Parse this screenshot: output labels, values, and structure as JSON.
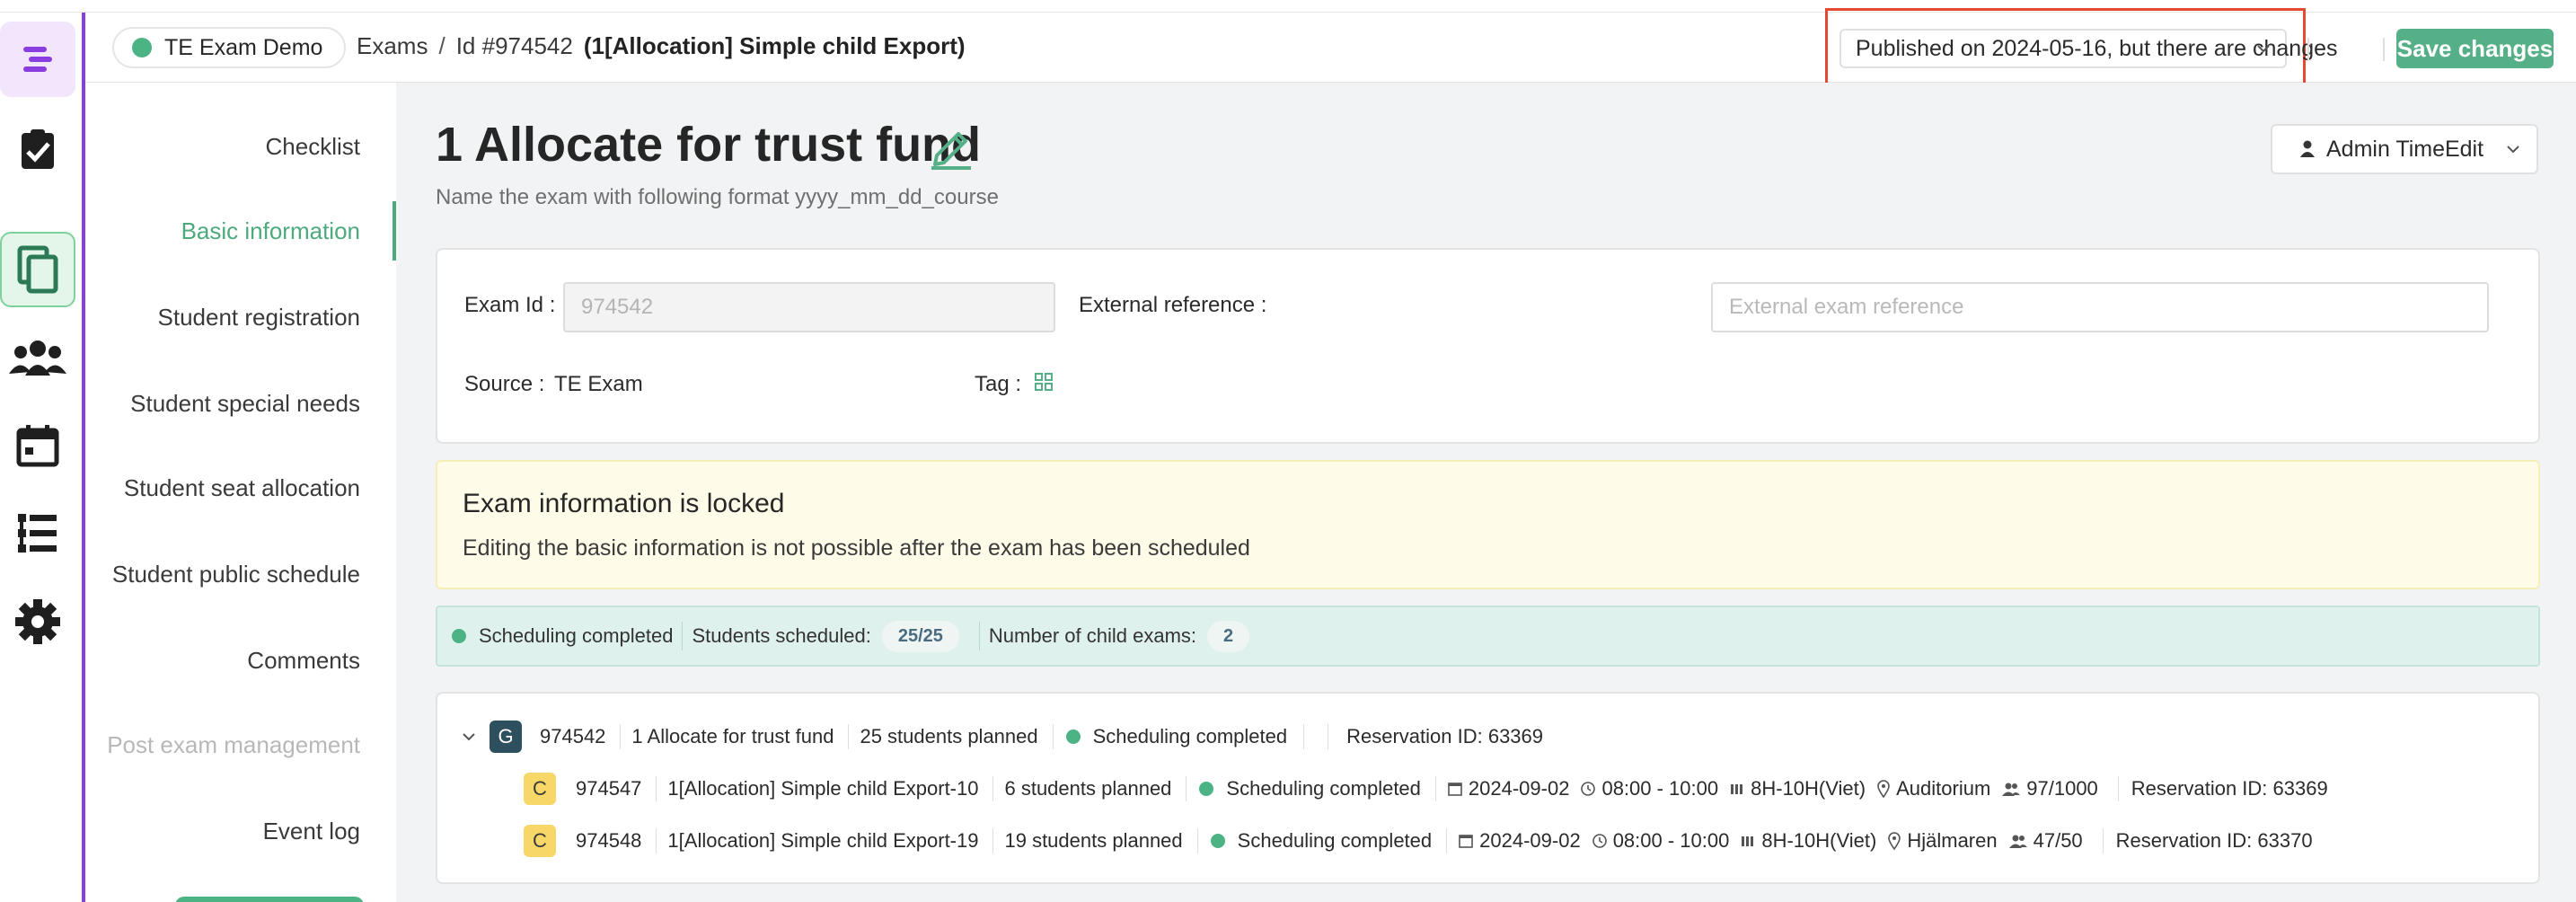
{
  "header": {
    "org_name": "TE Exam Demo",
    "breadcrumb_root": "Exams",
    "breadcrumb_sep": "/",
    "breadcrumb_id": "Id #974542",
    "breadcrumb_name": "(1[Allocation] Simple child Export)",
    "publish_status": "Published on 2024-05-16, but there are changes",
    "save_label": "Save changes",
    "colors": {
      "accent": "#55b087",
      "highlight": "#e44a33",
      "rail_line": "#8a3ee0"
    }
  },
  "rail": {
    "items": [
      {
        "name": "logo",
        "icon": "logo-icon"
      },
      {
        "name": "tasks",
        "icon": "clipboard-check-icon"
      },
      {
        "name": "exams",
        "icon": "copy-icon",
        "active": true
      },
      {
        "name": "users",
        "icon": "users-icon"
      },
      {
        "name": "calendar",
        "icon": "calendar-icon"
      },
      {
        "name": "list",
        "icon": "list-icon"
      },
      {
        "name": "settings",
        "icon": "gear-icon"
      }
    ]
  },
  "sections": {
    "items": [
      {
        "label": "Checklist"
      },
      {
        "label": "Basic information",
        "active": true
      },
      {
        "label": "Student registration"
      },
      {
        "label": "Student special needs"
      },
      {
        "label": "Student seat allocation"
      },
      {
        "label": "Student public schedule"
      },
      {
        "label": "Comments"
      },
      {
        "label": "Post exam management",
        "disabled": true
      },
      {
        "label": "Event log"
      }
    ]
  },
  "main": {
    "title": "1 Allocate for trust fund",
    "subtitle": "Name the exam with following format yyyy_mm_dd_course",
    "user_menu": "Admin TimeEdit"
  },
  "basic_info": {
    "exam_id_label": "Exam Id :",
    "exam_id_value": "974542",
    "external_ref_label": "External reference :",
    "external_ref_placeholder": "External exam reference",
    "source_label": "Source :",
    "source_value": "TE Exam",
    "tag_label": "Tag :"
  },
  "lock_notice": {
    "title": "Exam information is locked",
    "text": "Editing the basic information is not possible after the exam has been scheduled"
  },
  "status_bar": {
    "status": "Scheduling completed",
    "students_label": "Students scheduled:",
    "students_value": "25/25",
    "children_label": "Number of child exams:",
    "children_value": "2"
  },
  "tree": {
    "parent": {
      "badge": "G",
      "id": "974542",
      "name": "1 Allocate for trust fund",
      "planned": "25 students planned",
      "status": "Scheduling completed",
      "reservation": "Reservation ID: 63369"
    },
    "children": [
      {
        "badge": "C",
        "id": "974547",
        "name": "1[Allocation] Simple child Export-10",
        "planned": "6 students planned",
        "status": "Scheduling completed",
        "date": "2024-09-02",
        "time": "08:00 - 10:00",
        "group": "8H-10H(Viet)",
        "room": "Auditorium",
        "capacity": "97/1000",
        "reservation": "Reservation ID: 63369"
      },
      {
        "badge": "C",
        "id": "974548",
        "name": "1[Allocation] Simple child Export-19",
        "planned": "19 students planned",
        "status": "Scheduling completed",
        "date": "2024-09-02",
        "time": "08:00 - 10:00",
        "group": "8H-10H(Viet)",
        "room": "Hjälmaren",
        "capacity": "47/50",
        "reservation": "Reservation ID: 63370"
      }
    ]
  }
}
